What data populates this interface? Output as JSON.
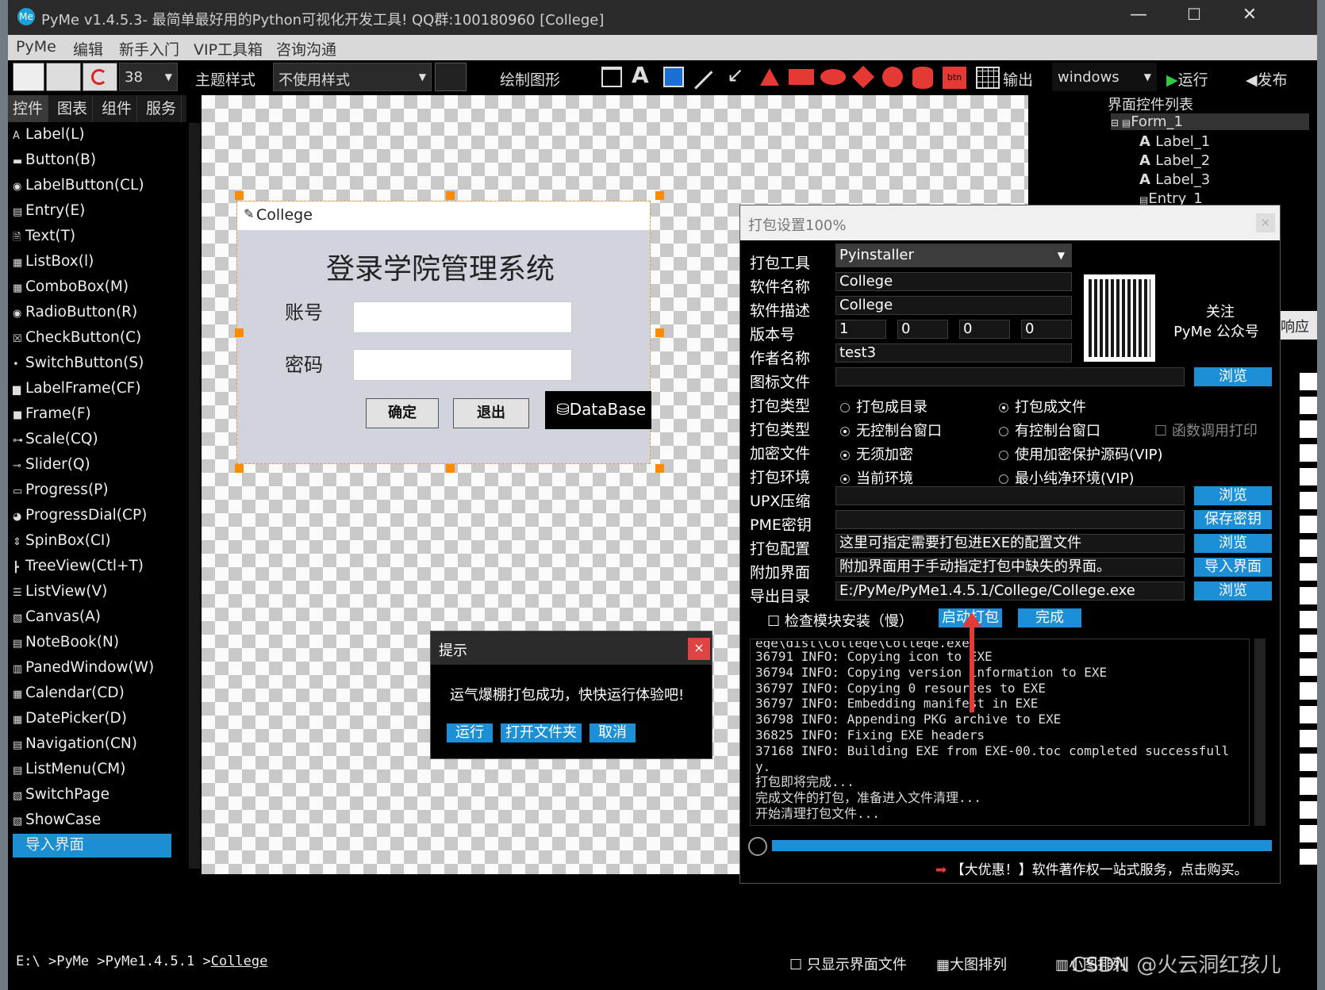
{
  "window": {
    "title": "PyMe v1.4.5.3- 最简单最好用的Python可视化开发工具! QQ群:100180960    [College]",
    "logo": "Me"
  },
  "menu": [
    "PyMe",
    "编辑",
    "新手入门",
    "VIP工具箱",
    "咨询沟通"
  ],
  "toolbar": {
    "font_size": "38",
    "theme_label": "主题样式",
    "theme_value": "不使用样式",
    "draw_label": "绘制图形",
    "text_tool": "A",
    "btn_tool": "btn",
    "output_label": "输出",
    "platform": "windows",
    "run_label": "运行",
    "publish_label": "发布"
  },
  "left_tabs": [
    "控件",
    "图表",
    "组件",
    "服务"
  ],
  "left_items": [
    {
      "icon": "A",
      "label": "Label(L)"
    },
    {
      "icon": "▬",
      "label": "Button(B)"
    },
    {
      "icon": "◉",
      "label": "LabelButton(CL)"
    },
    {
      "icon": "▤",
      "label": "Entry(E)"
    },
    {
      "icon": "🗎",
      "label": "Text(T)"
    },
    {
      "icon": "▦",
      "label": "ListBox(l)"
    },
    {
      "icon": "▦",
      "label": "ComboBox(M)"
    },
    {
      "icon": "◉",
      "label": "RadioButton(R)"
    },
    {
      "icon": "☒",
      "label": "CheckButton(C)"
    },
    {
      "icon": "•",
      "label": "SwitchButton(S)"
    },
    {
      "icon": "▆",
      "label": "LabelFrame(CF)"
    },
    {
      "icon": "■",
      "label": "Frame(F)"
    },
    {
      "icon": "⊶",
      "label": "Scale(CQ)"
    },
    {
      "icon": "⊸",
      "label": "Slider(Q)"
    },
    {
      "icon": "▭",
      "label": "Progress(P)"
    },
    {
      "icon": "◕",
      "label": "ProgressDial(CP)"
    },
    {
      "icon": "⇕",
      "label": "SpinBox(CI)"
    },
    {
      "icon": "┣",
      "label": "TreeView(Ctl+T)"
    },
    {
      "icon": "☰",
      "label": "ListView(V)"
    },
    {
      "icon": "▧",
      "label": "Canvas(A)"
    },
    {
      "icon": "▤",
      "label": "NoteBook(N)"
    },
    {
      "icon": "▥",
      "label": "PanedWindow(W)"
    },
    {
      "icon": "▦",
      "label": "Calendar(CD)"
    },
    {
      "icon": "▦",
      "label": "DatePicker(D)"
    },
    {
      "icon": "▤",
      "label": "Navigation(CN)"
    },
    {
      "icon": "▤",
      "label": "ListMenu(CM)"
    },
    {
      "icon": "▧",
      "label": "SwitchPage"
    },
    {
      "icon": "▧",
      "label": "ShowCase"
    },
    {
      "icon": "",
      "label": "导入界面"
    }
  ],
  "form": {
    "title": "College",
    "heading": "登录学院管理系统",
    "account_label": "账号",
    "password_label": "密码",
    "ok": "确定",
    "exit": "退出",
    "db": "DataBase"
  },
  "right_panel": {
    "title": "界面控件列表",
    "root": "Form_1",
    "children": [
      "Label_1",
      "Label_2",
      "Label_3",
      "Entry_1"
    ],
    "side_tab": "响应"
  },
  "pack": {
    "title": "打包设置100%",
    "tool_label": "打包工具",
    "tool_value": "Pyinstaller",
    "name_label": "软件名称",
    "name_value": "College",
    "desc_label": "软件描述",
    "desc_value": "College",
    "ver_label": "版本号",
    "ver": [
      "1",
      "0",
      "0",
      "0"
    ],
    "author_label": "作者名称",
    "author_value": "test3",
    "icon_label": "图标文件",
    "follow1": "关注",
    "follow2": "PyMe 公众号",
    "type_label": "打包类型",
    "type_a": "打包成目录",
    "type_b": "打包成文件",
    "type2_label": "打包类型",
    "type2_a": "无控制台窗口",
    "type2_b": "有控制台窗口",
    "type2_c": "函数调用打印",
    "enc_label": "加密文件",
    "enc_a": "无须加密",
    "enc_b": "使用加密保护源码(VIP)",
    "env_label": "打包环境",
    "env_a": "当前环境",
    "env_b": "最小纯净环境(VIP)",
    "upx_label": "UPX压缩",
    "pme_label": "PME密钥",
    "cfg_label": "打包配置",
    "cfg_value": "这里可指定需要打包进EXE的配置文件",
    "extra_label": "附加界面",
    "extra_value": "附加界面用于手动指定打包中缺失的界面。",
    "out_label": "导出目录",
    "out_value": "E:/PyMe/PyMe1.4.5.1/College/College.exe",
    "browse": "浏览",
    "save_key": "保存密钥",
    "import_ui": "导入界面",
    "check_module": "检查模块安装（慢）",
    "start": "启动打包",
    "done": "完成",
    "log": [
      "ege\\dist\\College\\College.exe",
      "36791 INFO: Copying icon to EXE",
      "36794 INFO: Copying version information to EXE",
      "36797 INFO: Copying 0 resources to EXE",
      "36797 INFO: Embedding manifest in EXE",
      "36798 INFO: Appending PKG archive to EXE",
      "36825 INFO: Fixing EXE headers",
      "37168 INFO: Building EXE from EXE-00.toc completed successfull",
      "y.",
      "打包即将完成...",
      "完成文件的打包，准备进入文件清理...",
      "开始清理打包文件..."
    ],
    "progress": 1.0,
    "promo": "【大优惠！】软件著作权一站式服务，点击购买。"
  },
  "prompt": {
    "title": "提示",
    "close": "×",
    "message": "运气爆棚打包成功，快快运行体验吧!",
    "run": "运行",
    "open_folder": "打开文件夹",
    "cancel": "取消"
  },
  "status": {
    "path": [
      "E:\\",
      "PyMe",
      "PyMe1.4.5.1",
      "College"
    ],
    "only_ui": "只显示界面文件",
    "big_icons": "大图排列",
    "small_icons": "小图排列",
    "watermark": "CSDN @火云洞红孩儿"
  },
  "colors": {
    "accent": "#1c8fd6",
    "handle": "#ff8c00",
    "arrow": "#e53935"
  }
}
